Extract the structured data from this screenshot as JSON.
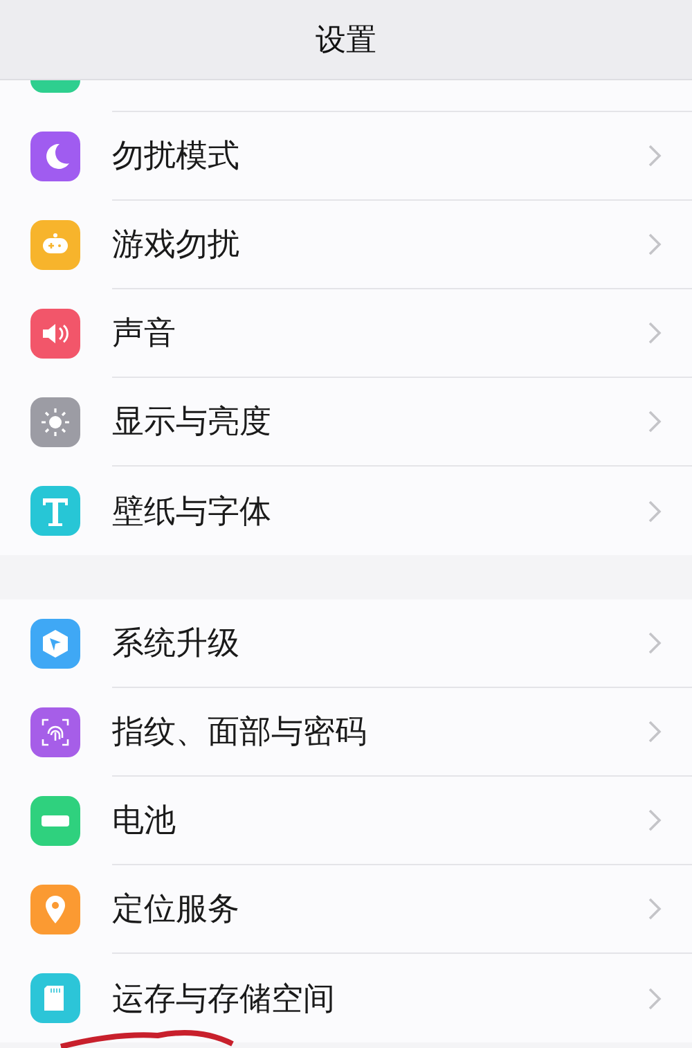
{
  "header": {
    "title": "设置"
  },
  "sections": [
    {
      "items": [
        {
          "color": "#2ecf8f"
        },
        {
          "label": "勿扰模式",
          "color": "#a05cf0"
        },
        {
          "label": "游戏勿扰",
          "color": "#f7b42c"
        },
        {
          "label": "声音",
          "color": "#f2566a"
        },
        {
          "label": "显示与亮度",
          "color": "#9c9ca4"
        },
        {
          "label": "壁纸与字体",
          "color": "#27c6d6"
        }
      ]
    },
    {
      "items": [
        {
          "label": "系统升级",
          "color": "#3fa8f5"
        },
        {
          "label": "指纹、面部与密码",
          "color": "#a65ee8"
        },
        {
          "label": "电池",
          "color": "#2fd17e"
        },
        {
          "label": "定位服务",
          "color": "#fb9a32"
        },
        {
          "label": "运存与存储空间",
          "color": "#2cc5d8"
        }
      ]
    }
  ]
}
